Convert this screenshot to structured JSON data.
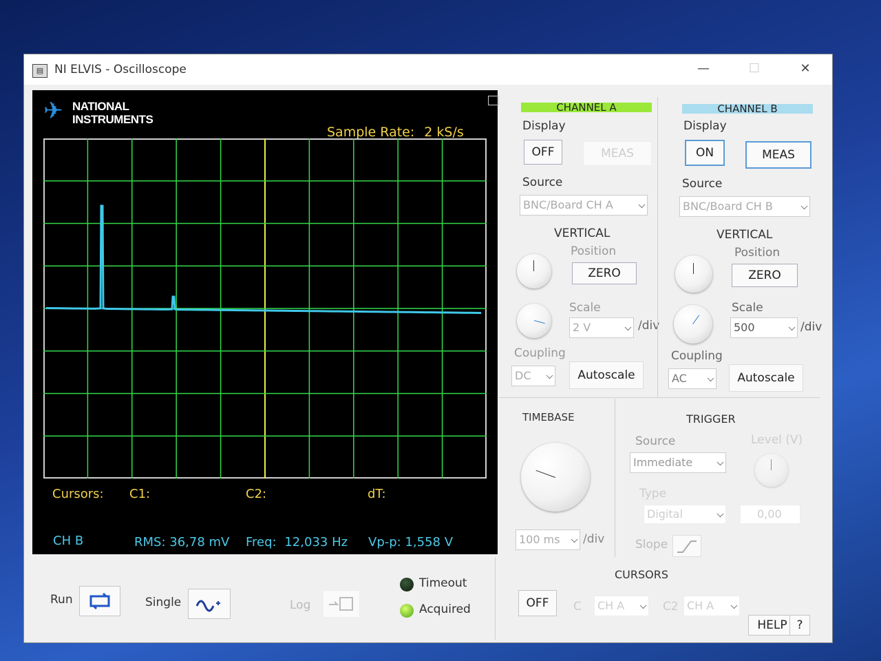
{
  "window": {
    "title": "NI ELVIS - Oscilloscope",
    "minimize": "—",
    "maximize": "☐",
    "close": "✕",
    "icon": "app-icon"
  },
  "scope": {
    "logo_line1": "NATIONAL",
    "logo_line2": "INSTRUMENTS",
    "sample_rate_label": "Sample Rate:",
    "sample_rate_value": "2 kS/s",
    "cursors_label": "Cursors:",
    "c1_label": "C1:",
    "c2_label": "C2:",
    "dt_label": "dT:",
    "channel_label": "CH B",
    "rms_label": "RMS:",
    "rms_value": "36,78 mV",
    "freq_label": "Freq:",
    "freq_value": "12,033 Hz",
    "vpp_label": "Vp-p:",
    "vpp_value": "1,558 V",
    "trace_color": "#3fc8e8",
    "grid_color": "#33d94a",
    "center_line_color": "#e8f04a"
  },
  "channel_a": {
    "header": "CHANNEL A",
    "display_label": "Display",
    "off_btn": "OFF",
    "meas_btn": "MEAS",
    "source_label": "Source",
    "source_value": "BNC/Board CH A",
    "vertical_label": "VERTICAL",
    "position_label": "Position",
    "zero_btn": "ZERO",
    "scale_label": "Scale",
    "scale_value": "2 V",
    "per_div": "/div",
    "coupling_label": "Coupling",
    "coupling_value": "DC",
    "autoscale_btn": "Autoscale",
    "header_color": "#9be83a"
  },
  "channel_b": {
    "header": "CHANNEL B",
    "display_label": "Display",
    "on_btn": "ON",
    "meas_btn": "MEAS",
    "source_label": "Source",
    "source_value": "BNC/Board CH B",
    "vertical_label": "VERTICAL",
    "position_label": "Position",
    "zero_btn": "ZERO",
    "scale_label": "Scale",
    "scale_value": "500",
    "per_div": "/div",
    "coupling_label": "Coupling",
    "coupling_value": "AC",
    "autoscale_btn": "Autoscale",
    "header_color": "#a9dcef"
  },
  "timebase": {
    "label": "TIMEBASE",
    "value": "100 ms",
    "per_div": "/div"
  },
  "trigger": {
    "label": "TRIGGER",
    "source_label": "Source",
    "source_value": "Immediate",
    "level_label": "Level (V)",
    "level_value": "0,00",
    "type_label": "Type",
    "type_value": "Digital",
    "slope_label": "Slope"
  },
  "cursors": {
    "label": "CURSORS",
    "off_btn": "OFF",
    "c_label": "C",
    "c_value": "CH A",
    "c2_label": "C2",
    "c2_value": "CH A"
  },
  "bottom": {
    "run_label": "Run",
    "single_label": "Single",
    "log_label": "Log",
    "timeout_label": "Timeout",
    "acquired_label": "Acquired",
    "help_btn": "HELP",
    "question_btn": "?"
  }
}
